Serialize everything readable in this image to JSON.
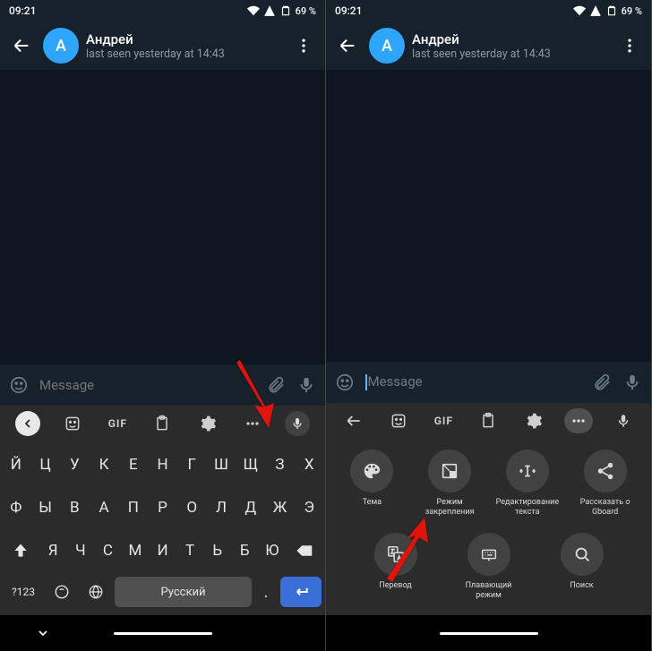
{
  "status": {
    "time": "09:21",
    "battery": "69 %"
  },
  "chat": {
    "avatar_initial": "А",
    "name": "Андрей",
    "status": "last seen yesterday at 14:43",
    "message_placeholder": "Message"
  },
  "keyboard": {
    "gif_label": "GIF",
    "rows": [
      [
        "Й",
        "Ц",
        "У",
        "К",
        "Е",
        "Н",
        "Г",
        "Ш",
        "Щ",
        "З",
        "Х"
      ],
      [
        "Ф",
        "Ы",
        "В",
        "А",
        "П",
        "Р",
        "О",
        "Л",
        "Д",
        "Ж",
        "Э"
      ],
      [
        "Я",
        "Ч",
        "С",
        "М",
        "И",
        "Т",
        "Ь",
        "Б",
        "Ю"
      ]
    ],
    "sym": "?123",
    "space_label": "Русский",
    "dot": "."
  },
  "quick": {
    "row1": [
      {
        "id": "theme",
        "label": "Тема"
      },
      {
        "id": "dock",
        "label": "Режим закрепления"
      },
      {
        "id": "textedit",
        "label": "Редактирование текста"
      },
      {
        "id": "share",
        "label": "Рассказать о Gboard"
      }
    ],
    "row2": [
      {
        "id": "translate",
        "label": "Перевод"
      },
      {
        "id": "float",
        "label": "Плавающий режим"
      },
      {
        "id": "search",
        "label": "Поиск"
      }
    ]
  }
}
